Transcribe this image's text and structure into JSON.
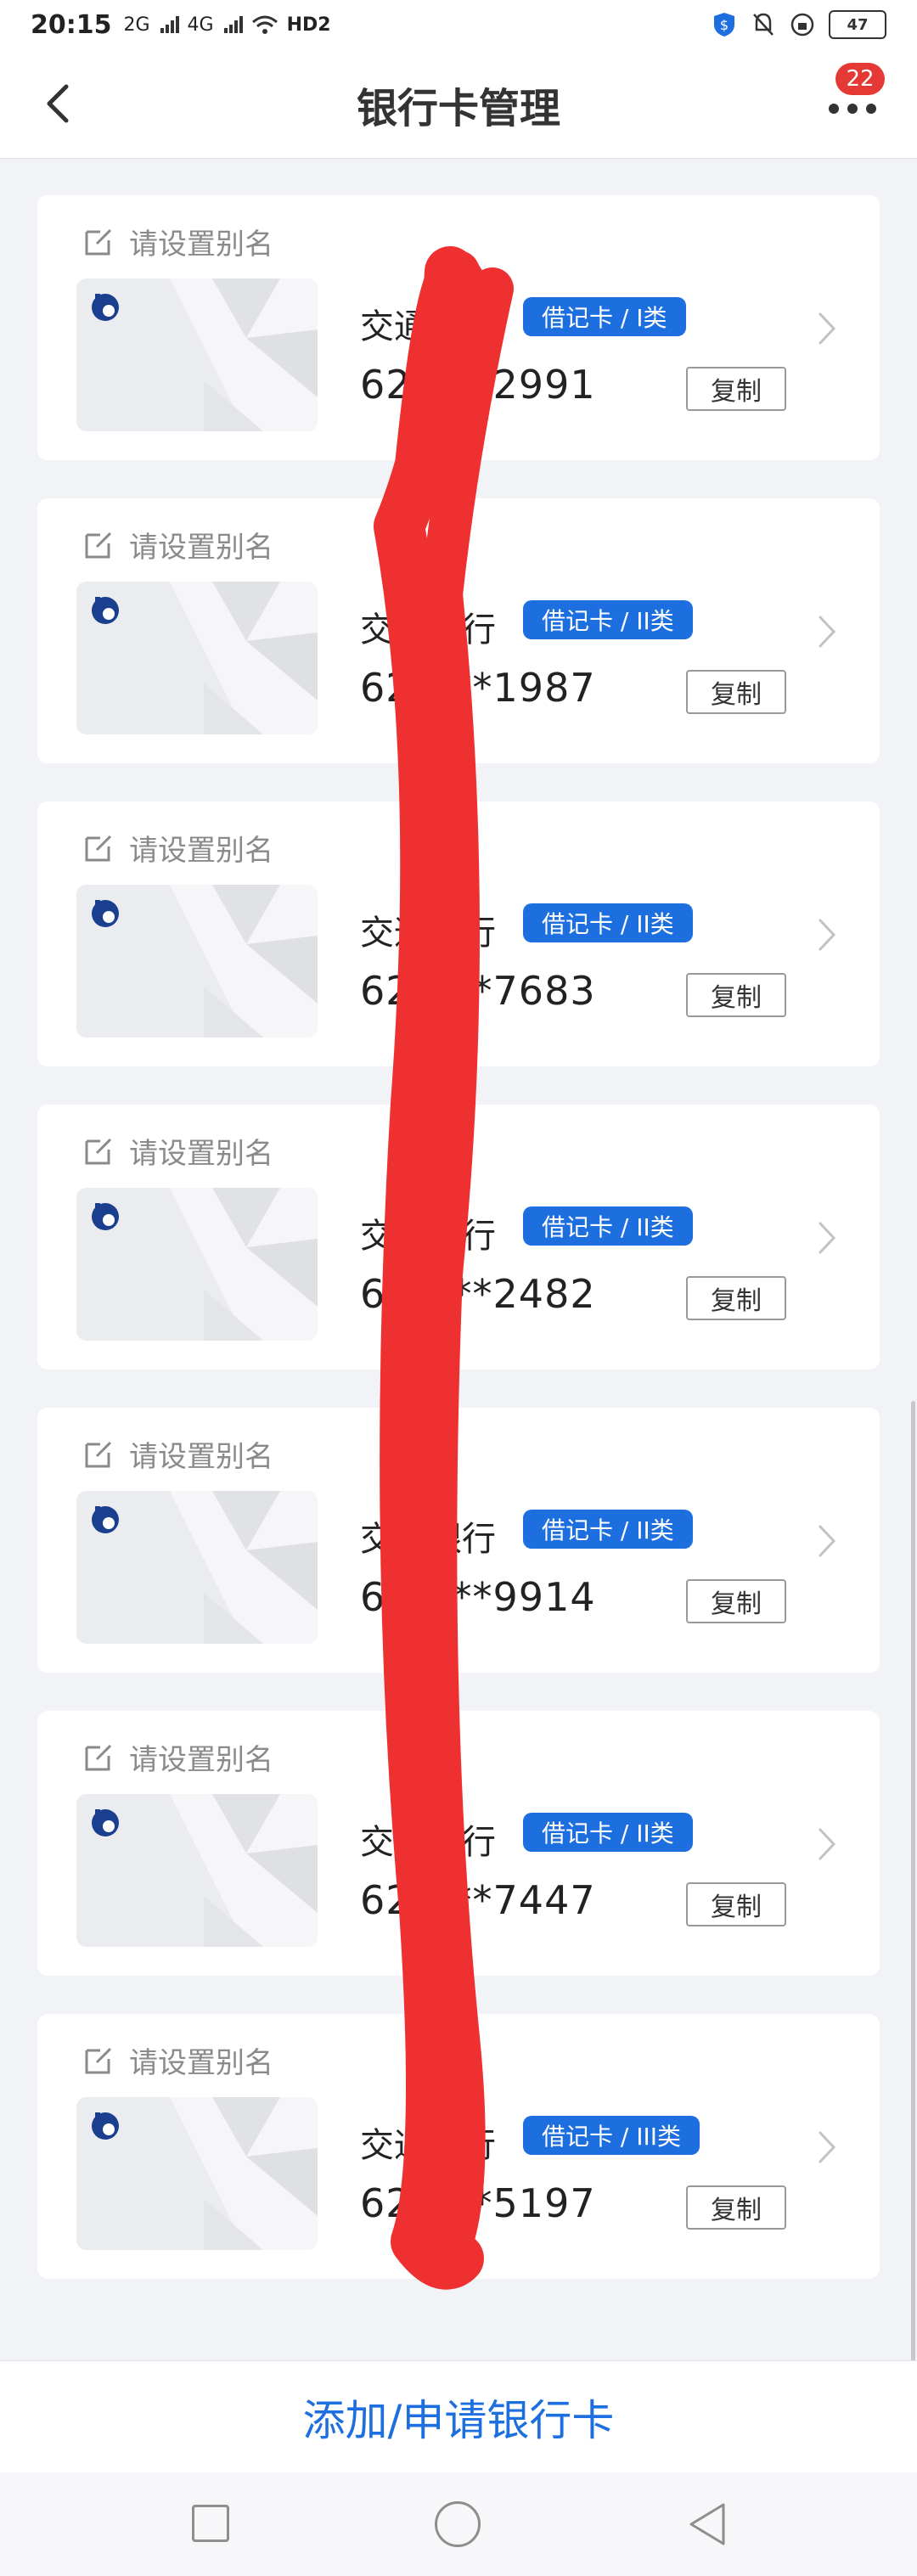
{
  "status_bar": {
    "time": "20:15",
    "network_2g": "2G",
    "network_4g": "4G",
    "hd_label": "HD2",
    "battery": "47"
  },
  "header": {
    "title": "银行卡管理",
    "notification_count": "22"
  },
  "cards": [
    {
      "alias": "请设置别名",
      "bank_name": "交通银行",
      "tag": "借记卡 / I类",
      "number": "62****2991",
      "copy_label": "复制"
    },
    {
      "alias": "请设置别名",
      "bank_name": "交通银行",
      "tag": "借记卡 / II类",
      "number": "62****1987",
      "copy_label": "复制"
    },
    {
      "alias": "请设置别名",
      "bank_name": "交通银行",
      "tag": "借记卡 / II类",
      "number": "62****7683",
      "copy_label": "复制"
    },
    {
      "alias": "请设置别名",
      "bank_name": "交通银行",
      "tag": "借记卡 / II类",
      "number": "62****2482",
      "copy_label": "复制"
    },
    {
      "alias": "请设置别名",
      "bank_name": "交通银行",
      "tag": "借记卡 / II类",
      "number": "62****9914",
      "copy_label": "复制"
    },
    {
      "alias": "请设置别名",
      "bank_name": "交通银行",
      "tag": "借记卡 / II类",
      "number": "62****7447",
      "copy_label": "复制"
    },
    {
      "alias": "请设置别名",
      "bank_name": "交通银行",
      "tag": "借记卡 / III类",
      "number": "62****5197",
      "copy_label": "复制"
    }
  ],
  "bottom": {
    "add_label": "添加/申请银行卡"
  },
  "colors": {
    "accent": "#1d6fe0",
    "badge": "#e53935",
    "scribble": "#ee3030",
    "background": "#f2f3f7"
  },
  "icons": {
    "back": "chevron-left-icon",
    "more": "more-dots-icon",
    "edit": "edit-icon",
    "chevron": "chevron-right-icon",
    "logo": "bank-logo-icon"
  }
}
